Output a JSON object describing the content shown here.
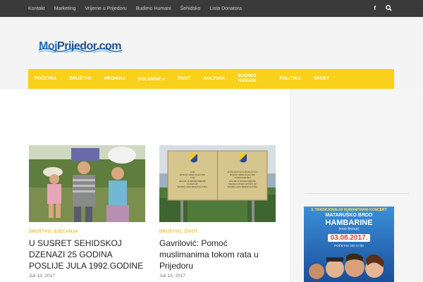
{
  "topbar": {
    "links": [
      "Kontakt",
      "Marketing",
      "Vrijeme u Prijedoru",
      "Budimo Humani",
      "Šehidsko",
      "Lista Donatora"
    ],
    "icons": [
      "facebook-icon",
      "search-icon"
    ]
  },
  "logo": {
    "part1": "Moj",
    "part2": "Prijedor.com"
  },
  "nav": {
    "items": [
      "Početna",
      "Društvo",
      "Hronika",
      "Kolumne",
      "Život",
      "Kultura",
      "Budimo Humani",
      "Politika",
      "Sport"
    ],
    "dropdown_index": 3
  },
  "posts": [
    {
      "categories": "Društvo, Sjećanja",
      "title": "U SUSRET SEHIDSKOJ DZENAZI 25 GODINA POSLIJE JULA 1992.GODINE",
      "date": "Juli 13, 2017"
    },
    {
      "categories": "Društvo, Život",
      "title": "Gavrilović: Pomoć muslimanima tokom rata u Prijedoru",
      "date": "Juli 13, 2017"
    }
  ],
  "sign": {
    "lines_left": [
      "SUD",
      "BOSNE I HERCEGOVINE",
      "СУД",
      "БОСНЕ И ХЕРЦЕГОВИНЕ",
      "COURT OF",
      "BOSNIA AND HERZEGOVINA"
    ],
    "lines_right": [
      "TUŽILAŠTVO/TUŽITELJSTVO",
      "BOSNE I HERCEGOVINE",
      "ТУЖИЛАШТВО",
      "БОСНЕ И ХЕРЦЕГОВИНЕ",
      "PROSECUTOR'S OFFICE OF",
      "BOSNIA AND HERZEGOVINA"
    ]
  },
  "ad": {
    "line1": "3. TRADICIONALNI HUMANITARNI KONCERT",
    "line2": "MATARUŠKO BRDO",
    "line3": "HAMBARINE",
    "line4": "(KOD ŠKOLE)",
    "date": "03.08.2017.",
    "time": "POČETAK OD 17:00"
  },
  "colors": {
    "accent": "#f9d11a",
    "category": "#f3b82f",
    "topbar": "#3a3a3a"
  }
}
